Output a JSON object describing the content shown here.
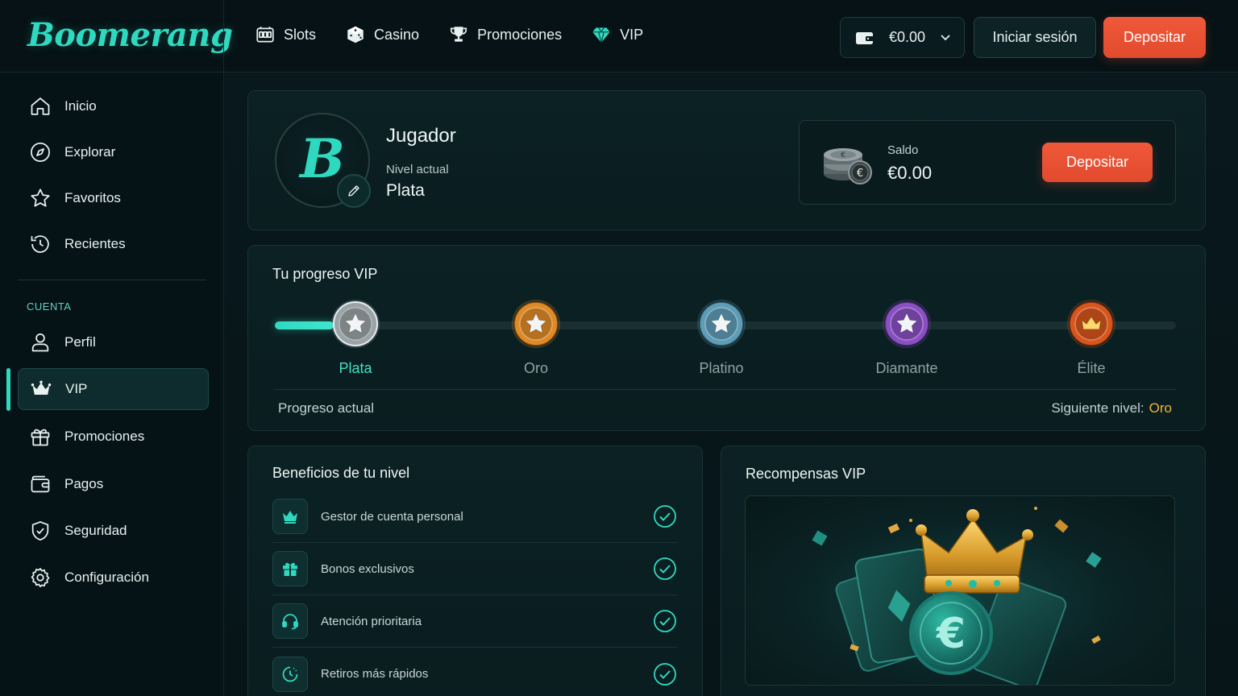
{
  "brand": {
    "logo": "Boomerang"
  },
  "topnav": [
    {
      "label": "Slots",
      "icon": "slot-machine-icon"
    },
    {
      "label": "Casino",
      "icon": "dice-icon"
    },
    {
      "label": "Promociones",
      "icon": "trophy-icon"
    },
    {
      "label": "VIP",
      "icon": "diamond-icon"
    }
  ],
  "header": {
    "wallet_amount": "€0.00",
    "login_label": "Iniciar sesión",
    "deposit_label": "Depositar"
  },
  "sidebar": {
    "items": [
      {
        "label": "Inicio",
        "icon": "home-icon"
      },
      {
        "label": "Explorar",
        "icon": "compass-icon"
      },
      {
        "label": "Favoritos",
        "icon": "star-icon"
      },
      {
        "label": "Recientes",
        "icon": "history-icon"
      }
    ],
    "section_title": "CUENTA",
    "account_items": [
      {
        "label": "Perfil",
        "icon": "user-icon"
      },
      {
        "label": "VIP",
        "icon": "crown-icon",
        "active": true
      },
      {
        "label": "Promociones",
        "icon": "gift-icon"
      },
      {
        "label": "Pagos",
        "icon": "wallet-icon"
      },
      {
        "label": "Seguridad",
        "icon": "shield-check-icon"
      },
      {
        "label": "Configuración",
        "icon": "gear-icon"
      }
    ]
  },
  "profile": {
    "avatar_letter": "B",
    "name": "Jugador",
    "level_label": "Nivel actual",
    "level_value": "Plata",
    "balance_label": "Saldo",
    "balance_value": "€0.00",
    "deposit_label": "Depositar"
  },
  "vip_progress": {
    "title": "Tu progreso VIP",
    "current_tier_index": 0,
    "progress_fraction": 0.065,
    "tiers": [
      {
        "name": "Plata",
        "color": "#9aa3a6",
        "icon": "star-medal-icon"
      },
      {
        "name": "Oro",
        "color": "#e08a25",
        "icon": "star-medal-icon"
      },
      {
        "name": "Platino",
        "color": "#5e9db8",
        "icon": "star-medal-icon"
      },
      {
        "name": "Diamante",
        "color": "#8a4fc4",
        "icon": "star-medal-icon"
      },
      {
        "name": "Élite",
        "color": "#d8561c",
        "icon": "crown-medal-icon"
      }
    ],
    "progress_label": "Progreso actual",
    "next_level_label": "Siguiente nivel:",
    "next_level_value": "Oro"
  },
  "benefits": {
    "title": "Beneficios de tu nivel",
    "items": [
      {
        "label": "Gestor de cuenta personal",
        "icon": "crown-icon"
      },
      {
        "label": "Bonos exclusivos",
        "icon": "gift-icon"
      },
      {
        "label": "Atención prioritaria",
        "icon": "headset-icon"
      },
      {
        "label": "Retiros más rápidos",
        "icon": "clock-icon"
      }
    ]
  },
  "rewards": {
    "title": "Recompensas VIP"
  },
  "colors": {
    "accent": "#2fd9c0",
    "deposit": "#e9502f",
    "gold": "#f2b53a",
    "background": "#07161a"
  }
}
